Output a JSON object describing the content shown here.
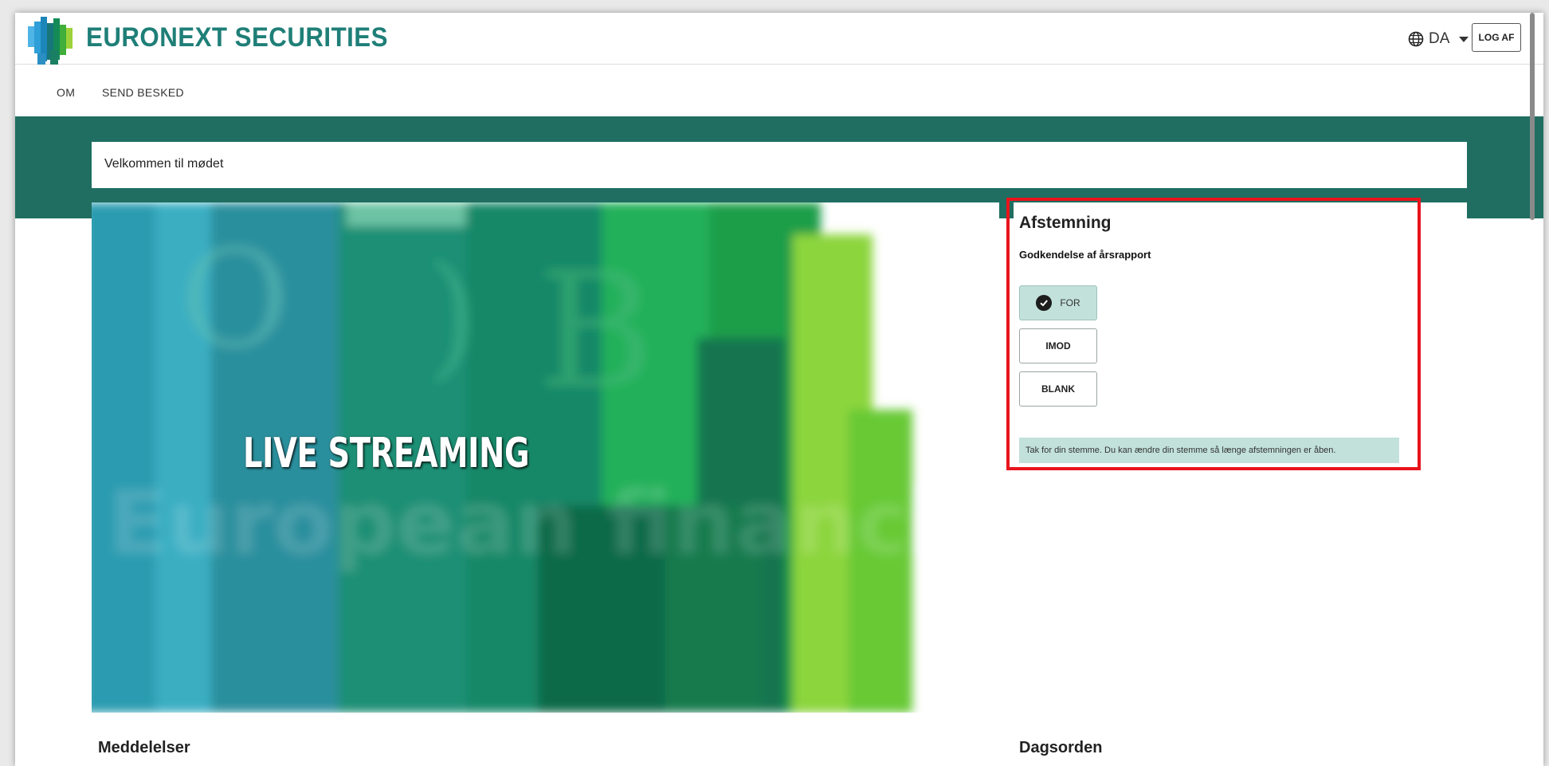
{
  "header": {
    "brand": "EURONEXT SECURITIES",
    "language": "DA",
    "logout_label": "LOG AF"
  },
  "nav": {
    "items": [
      {
        "label": "OM"
      },
      {
        "label": "SEND BESKED"
      }
    ]
  },
  "welcome": {
    "text": "Velkommen til mødet"
  },
  "stream": {
    "label": "LIVE STREAMING"
  },
  "voting": {
    "title": "Afstemning",
    "question": "Godkendelse af årsrapport",
    "options": [
      {
        "label": "FOR",
        "selected": true
      },
      {
        "label": "IMOD",
        "selected": false
      },
      {
        "label": "BLANK",
        "selected": false
      }
    ],
    "confirmation": "Tak for din stemme. Du kan ændre din stemme så længe afstemningen er åben."
  },
  "panels": {
    "announcements_title": "Meddelelser",
    "agenda_title": "Dagsorden"
  },
  "colors": {
    "brand_teal": "#1f7f78",
    "band_green": "#1f6e61",
    "selected_fill": "#c2e1da",
    "highlight_red": "#e8141c"
  },
  "icons": {
    "language": "globe-icon",
    "dropdown": "chevron-down-icon",
    "selected": "check-circle-icon"
  }
}
